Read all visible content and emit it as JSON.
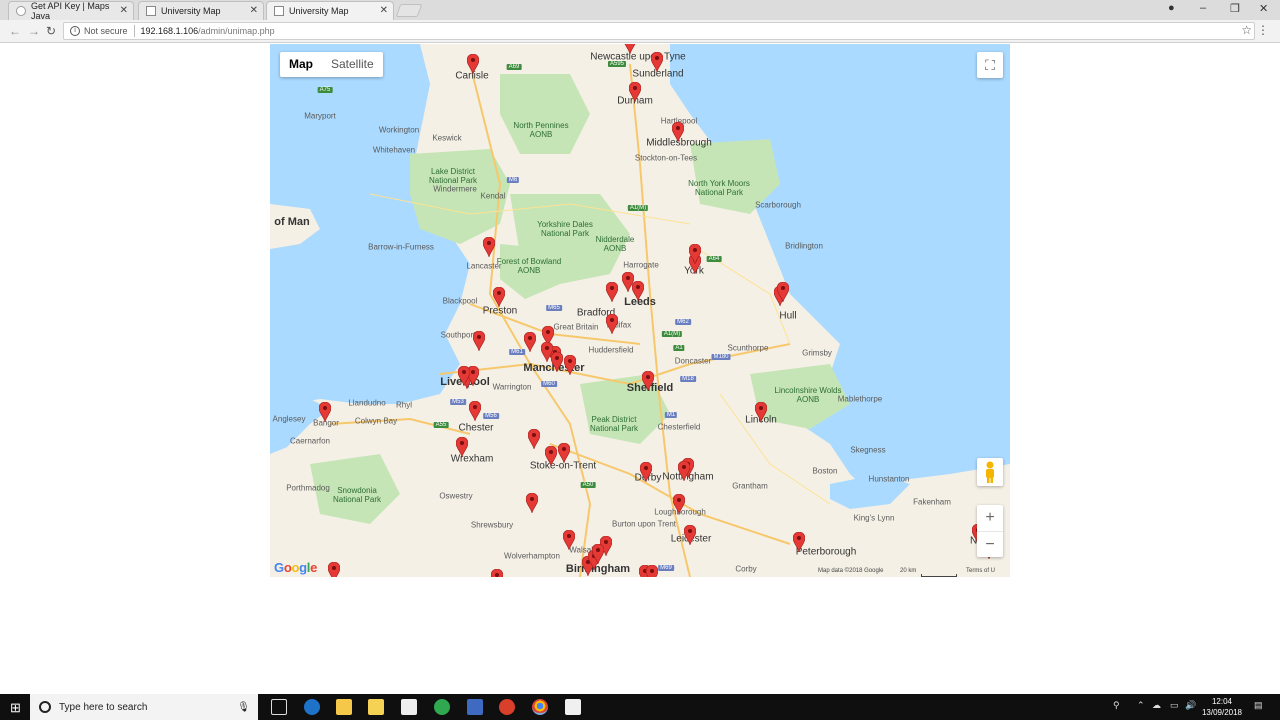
{
  "browser": {
    "tabs": [
      {
        "title": "Get API Key | Maps Java"
      },
      {
        "title": "University Map"
      },
      {
        "title": "University Map"
      }
    ],
    "security_label": "Not secure",
    "url_host": "192.168.1.106",
    "url_path": "/admin/unimap.php"
  },
  "map": {
    "type_control": {
      "map": "Map",
      "satellite": "Satellite"
    },
    "attribution": "Map data ©2018 Google",
    "scale": "20 km",
    "terms": "Terms of U",
    "logo": "Google",
    "marker_color": "#e53935",
    "labels": [
      {
        "text": "Newcastle upon Tyne",
        "kind": "city"
      },
      {
        "text": "Sunderland",
        "kind": "city"
      },
      {
        "text": "Carlisle",
        "kind": "city"
      },
      {
        "text": "Durham",
        "kind": "city"
      },
      {
        "text": "Hartlepool",
        "kind": "town"
      },
      {
        "text": "Middlesbrough",
        "kind": "city"
      },
      {
        "text": "Stockton-on-Tees",
        "kind": "town"
      },
      {
        "text": "Maryport",
        "kind": "town"
      },
      {
        "text": "Workington",
        "kind": "town"
      },
      {
        "text": "Whitehaven",
        "kind": "town"
      },
      {
        "text": "Keswick",
        "kind": "town"
      },
      {
        "text": "North Pennines AONB",
        "kind": "park"
      },
      {
        "text": "Lake District National Park",
        "kind": "park"
      },
      {
        "text": "Windermere",
        "kind": "town"
      },
      {
        "text": "Kendal",
        "kind": "town"
      },
      {
        "text": "North York Moors National Park",
        "kind": "park"
      },
      {
        "text": "Scarborough",
        "kind": "town"
      },
      {
        "text": "of Man",
        "kind": "big"
      },
      {
        "text": "Yorkshire Dales National Park",
        "kind": "park"
      },
      {
        "text": "Nidderdale AONB",
        "kind": "park"
      },
      {
        "text": "Barrow-in-Furness",
        "kind": "town"
      },
      {
        "text": "Lancaster",
        "kind": "town"
      },
      {
        "text": "Forest of Bowland AONB",
        "kind": "park"
      },
      {
        "text": "Harrogate",
        "kind": "town"
      },
      {
        "text": "York",
        "kind": "city"
      },
      {
        "text": "Bridlington",
        "kind": "town"
      },
      {
        "text": "Blackpool",
        "kind": "town"
      },
      {
        "text": "Preston",
        "kind": "city"
      },
      {
        "text": "Leeds",
        "kind": "big"
      },
      {
        "text": "Bradford",
        "kind": "city"
      },
      {
        "text": "Hull",
        "kind": "city"
      },
      {
        "text": "Southport",
        "kind": "town"
      },
      {
        "text": "Great Britain",
        "kind": "town"
      },
      {
        "text": "Halifax",
        "kind": "town"
      },
      {
        "text": "Huddersfield",
        "kind": "town"
      },
      {
        "text": "Scunthorpe",
        "kind": "town"
      },
      {
        "text": "Grimsby",
        "kind": "town"
      },
      {
        "text": "Manchester",
        "kind": "big"
      },
      {
        "text": "Doncaster",
        "kind": "town"
      },
      {
        "text": "Liverpool",
        "kind": "big"
      },
      {
        "text": "Warrington",
        "kind": "town"
      },
      {
        "text": "Sheffield",
        "kind": "big"
      },
      {
        "text": "Lincolnshire Wolds AONB",
        "kind": "park"
      },
      {
        "text": "Mablethorpe",
        "kind": "town"
      },
      {
        "text": "Anglesey",
        "kind": "town"
      },
      {
        "text": "Llandudno",
        "kind": "town"
      },
      {
        "text": "Rhyl",
        "kind": "town"
      },
      {
        "text": "Bangor",
        "kind": "town"
      },
      {
        "text": "Colwyn Bay",
        "kind": "town"
      },
      {
        "text": "Chester",
        "kind": "city"
      },
      {
        "text": "Peak District National Park",
        "kind": "park"
      },
      {
        "text": "Chesterfield",
        "kind": "town"
      },
      {
        "text": "Lincoln",
        "kind": "city"
      },
      {
        "text": "Caernarfon",
        "kind": "town"
      },
      {
        "text": "Skegness",
        "kind": "town"
      },
      {
        "text": "Wrexham",
        "kind": "city"
      },
      {
        "text": "Stoke-on-Trent",
        "kind": "city"
      },
      {
        "text": "Derby",
        "kind": "city"
      },
      {
        "text": "Nottingham",
        "kind": "city"
      },
      {
        "text": "Boston",
        "kind": "town"
      },
      {
        "text": "Snowdonia National Park",
        "kind": "park"
      },
      {
        "text": "Porthmadog",
        "kind": "town"
      },
      {
        "text": "Grantham",
        "kind": "town"
      },
      {
        "text": "Hunstanton",
        "kind": "town"
      },
      {
        "text": "Fakenham",
        "kind": "town"
      },
      {
        "text": "Oswestry",
        "kind": "town"
      },
      {
        "text": "Loughborough",
        "kind": "town"
      },
      {
        "text": "Burton upon Trent",
        "kind": "town"
      },
      {
        "text": "Shrewsbury",
        "kind": "town"
      },
      {
        "text": "King's Lynn",
        "kind": "town"
      },
      {
        "text": "Leicester",
        "kind": "city"
      },
      {
        "text": "Wolverhampton",
        "kind": "town"
      },
      {
        "text": "Walsall",
        "kind": "town"
      },
      {
        "text": "Peterborough",
        "kind": "city"
      },
      {
        "text": "Birmingham",
        "kind": "big"
      },
      {
        "text": "Corby",
        "kind": "town"
      },
      {
        "text": "Nor",
        "kind": "city"
      }
    ],
    "roads": [
      "A69",
      "A75",
      "A595",
      "M6",
      "A1(M)",
      "A64",
      "M65",
      "M61",
      "M62",
      "M60",
      "M1",
      "A1",
      "M18",
      "M180",
      "M53",
      "M56",
      "A55",
      "A50",
      "M69",
      "A1(M)"
    ]
  },
  "taskbar": {
    "search_placeholder": "Type here to search",
    "time": "12:04",
    "date": "13/09/2018"
  }
}
